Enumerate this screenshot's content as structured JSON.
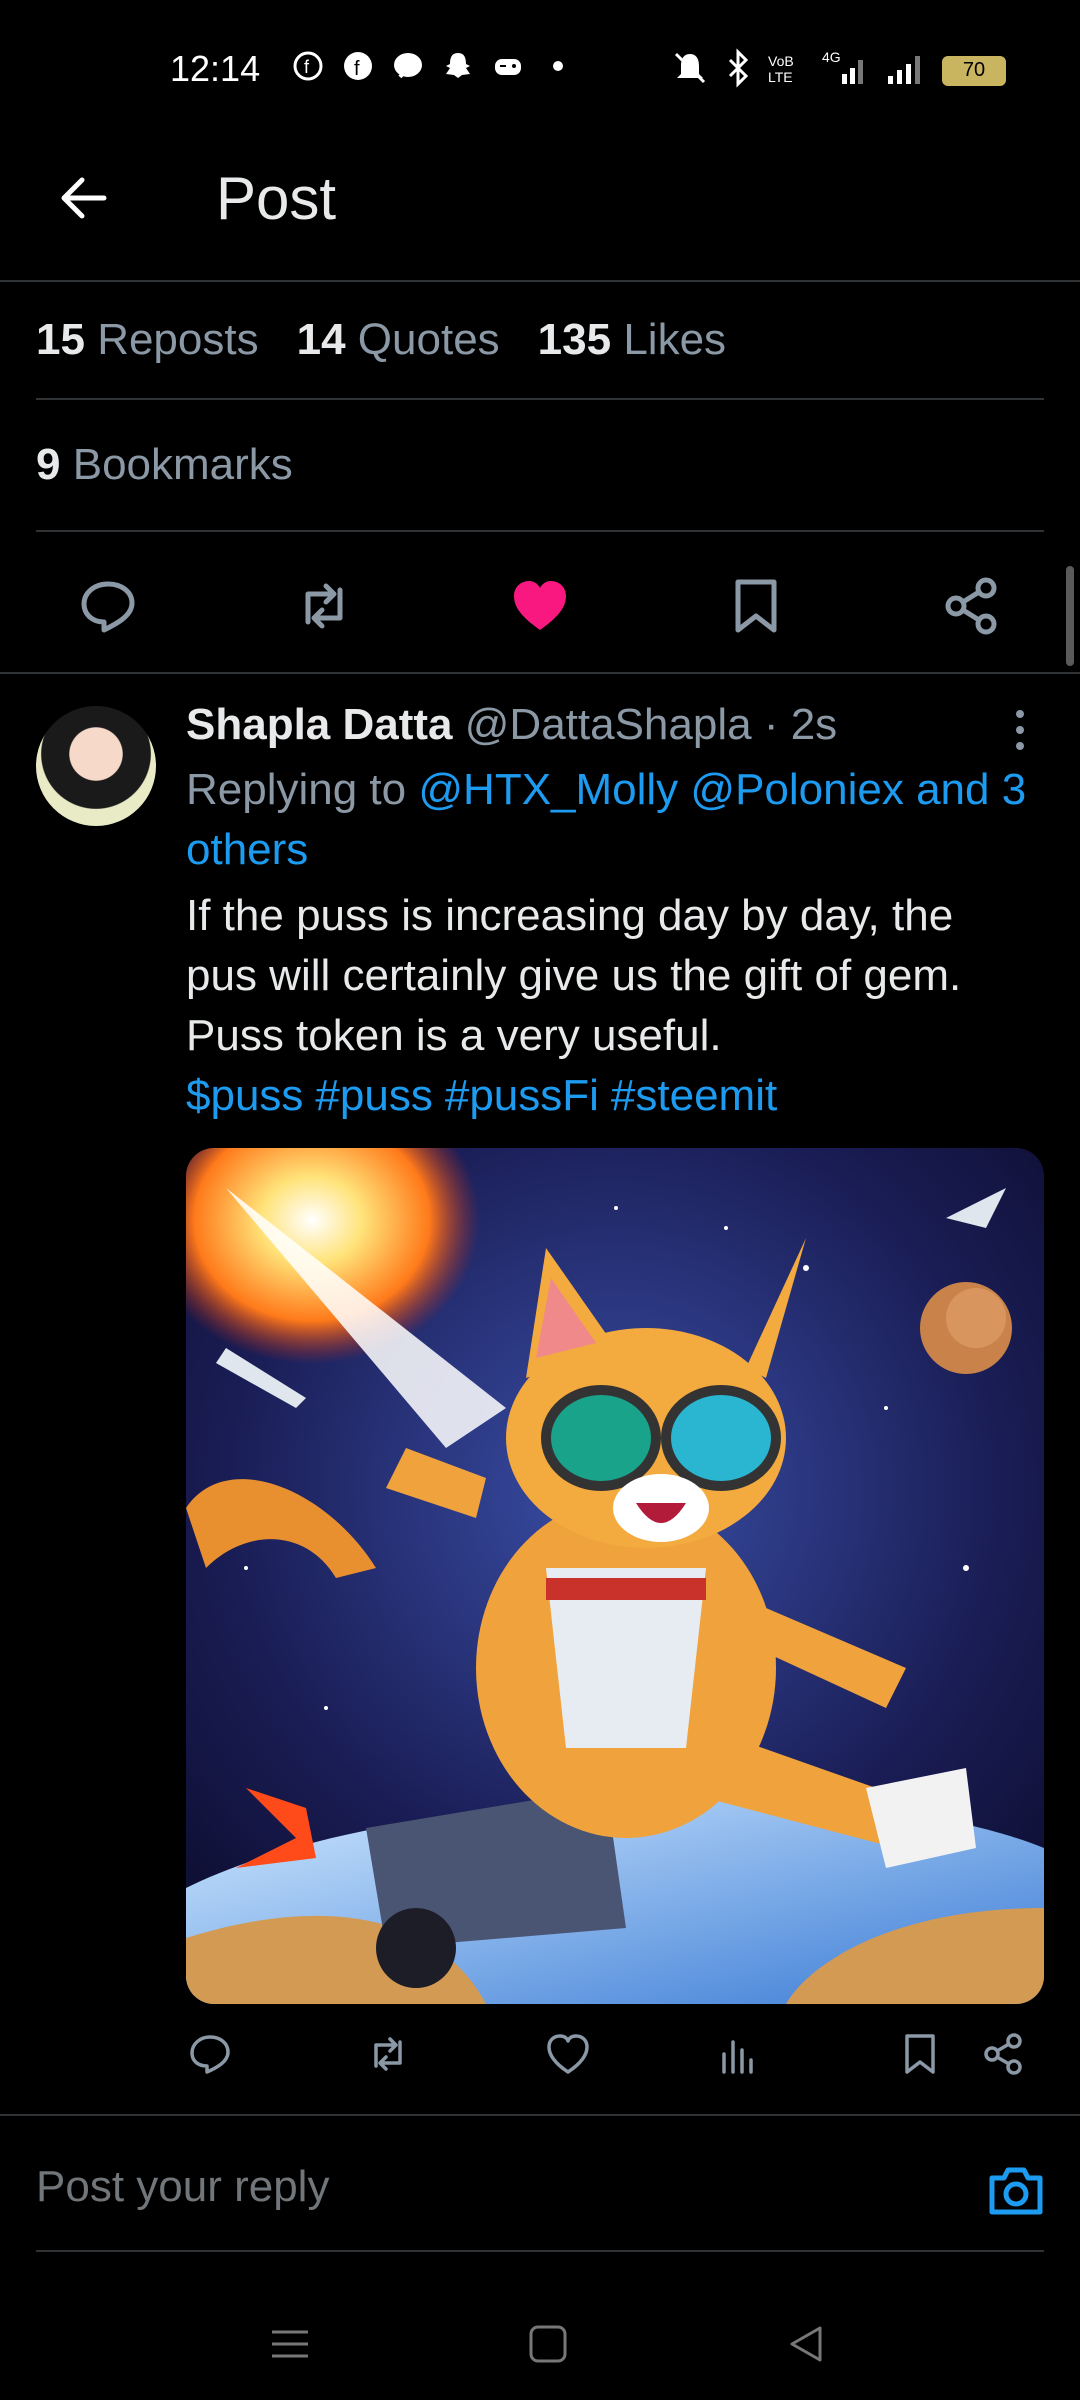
{
  "status_bar": {
    "time": "12:14",
    "battery": "70"
  },
  "header": {
    "title": "Post"
  },
  "stats": {
    "reposts_count": "15",
    "reposts_label": "Reposts",
    "quotes_count": "14",
    "quotes_label": "Quotes",
    "likes_count": "135",
    "likes_label": "Likes",
    "bookmarks_count": "9",
    "bookmarks_label": "Bookmarks"
  },
  "actions": {
    "liked": true,
    "like_color": "#f91880"
  },
  "reply": {
    "display_name": "Shapla Datta",
    "handle": "@DattaShapla",
    "time": "· 2s",
    "replying_prefix": "Replying to",
    "replying_users": "@HTX_Molly @Poloniex and 3 others",
    "text": "If the puss is increasing day by day, the pus will certainly give us the gift of gem. Puss token is a very useful.",
    "hashtags": [
      "$puss",
      "#puss",
      "#pussFi",
      "#steemit"
    ]
  },
  "composer": {
    "placeholder": "Post your reply"
  },
  "colors": {
    "background": "#000000",
    "link": "#1d9bf0",
    "muted": "#8b98a5",
    "divider": "#2f3336"
  },
  "icons": [
    "back-arrow-icon",
    "reply-icon",
    "repost-icon",
    "heart-icon",
    "bookmark-icon",
    "share-icon",
    "more-icon",
    "views-icon",
    "camera-icon",
    "menu-icon",
    "home-icon",
    "back-icon"
  ]
}
